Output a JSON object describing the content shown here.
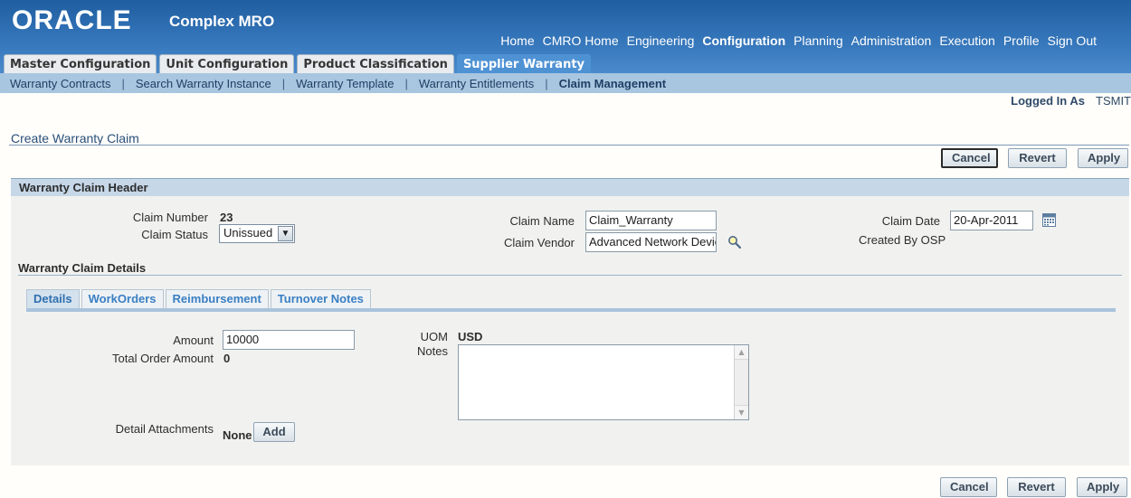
{
  "header": {
    "logo": "ORACLE",
    "app_name": "Complex MRO",
    "global_nav": [
      "Home",
      "CMRO Home",
      "Engineering",
      "Configuration",
      "Planning",
      "Administration",
      "Execution",
      "Profile",
      "Sign Out"
    ],
    "tabs": [
      "Master Configuration",
      "Unit Configuration",
      "Product Classification",
      "Supplier Warranty"
    ]
  },
  "subnav": [
    "Warranty Contracts",
    "Search Warranty Instance",
    "Warranty Template",
    "Warranty Entitlements",
    "Claim Management"
  ],
  "logged_in": {
    "label": "Logged In As",
    "user": "TSMIT"
  },
  "page_title": "Create Warranty Claim",
  "buttons": {
    "cancel": "Cancel",
    "revert": "Revert",
    "apply": "Apply",
    "add": "Add"
  },
  "header_section": {
    "title": "Warranty Claim Header",
    "claim_number_label": "Claim Number",
    "claim_number": "23",
    "claim_status_label": "Claim Status",
    "claim_status": "Unissued",
    "claim_name_label": "Claim Name",
    "claim_name": "Claim_Warranty",
    "claim_vendor_label": "Claim Vendor",
    "claim_vendor": "Advanced Network Devic",
    "claim_date_label": "Claim Date",
    "claim_date": "20-Apr-2011",
    "created_by_label": "Created By",
    "created_by": "OSP"
  },
  "details_section": {
    "title": "Warranty Claim Details",
    "tabs": [
      "Details",
      "WorkOrders",
      "Reimbursement",
      "Turnover Notes"
    ],
    "amount_label": "Amount",
    "amount": "10000",
    "total_order_label": "Total Order Amount",
    "total_order": "0",
    "uom_label": "UOM",
    "uom": "USD",
    "notes_label": "Notes",
    "attachments_label": "Detail Attachments",
    "attachments": "None"
  },
  "colors": {
    "header_blue": "#2f6fb3",
    "subnav": "#a9c6e0",
    "active_tab": "#4f92d4"
  }
}
